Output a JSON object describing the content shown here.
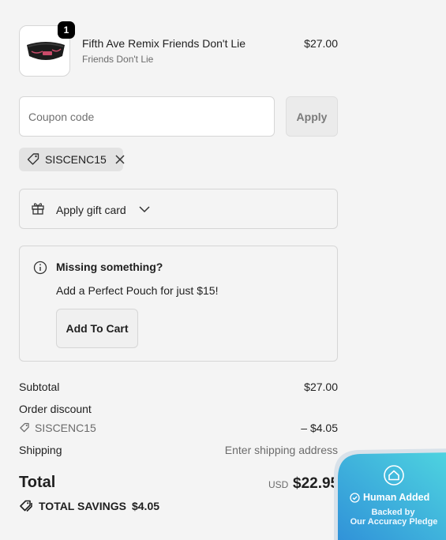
{
  "product": {
    "quantity": "1",
    "name": "Fifth Ave Remix Friends Don't Lie",
    "variant": "Friends Don't Lie",
    "price": "$27.00",
    "image_icon": "fanny-pack-image"
  },
  "coupon": {
    "placeholder": "Coupon code",
    "value": "",
    "apply_label": "Apply"
  },
  "applied_code": {
    "code": "SISCENC15",
    "icon": "tag-icon",
    "remove_icon": "close-icon"
  },
  "gift_card": {
    "label": "Apply gift card",
    "icon": "gift-icon",
    "toggle_icon": "chevron-down-icon"
  },
  "upsell": {
    "title": "Missing something?",
    "body": "Add a Perfect Pouch for just $15!",
    "button_label": "Add To Cart"
  },
  "summary": {
    "subtotal_label": "Subtotal",
    "subtotal_value": "$27.00",
    "discount_label": "Order discount",
    "discount_code": "SISCENC15",
    "discount_value": "– $4.05",
    "shipping_label": "Shipping",
    "shipping_value": "Enter shipping address",
    "total_label": "Total",
    "total_currency": "USD",
    "total_value": "$22.95",
    "savings_label": "TOTAL SAVINGS",
    "savings_value": "$4.05"
  },
  "badge": {
    "line1": "Human Added",
    "line2": "Backed by",
    "line3": "Our Accuracy Pledge",
    "colors": {
      "start": "#2f8fd8",
      "end": "#4fd6e0",
      "border": "#d9e2ea"
    }
  }
}
